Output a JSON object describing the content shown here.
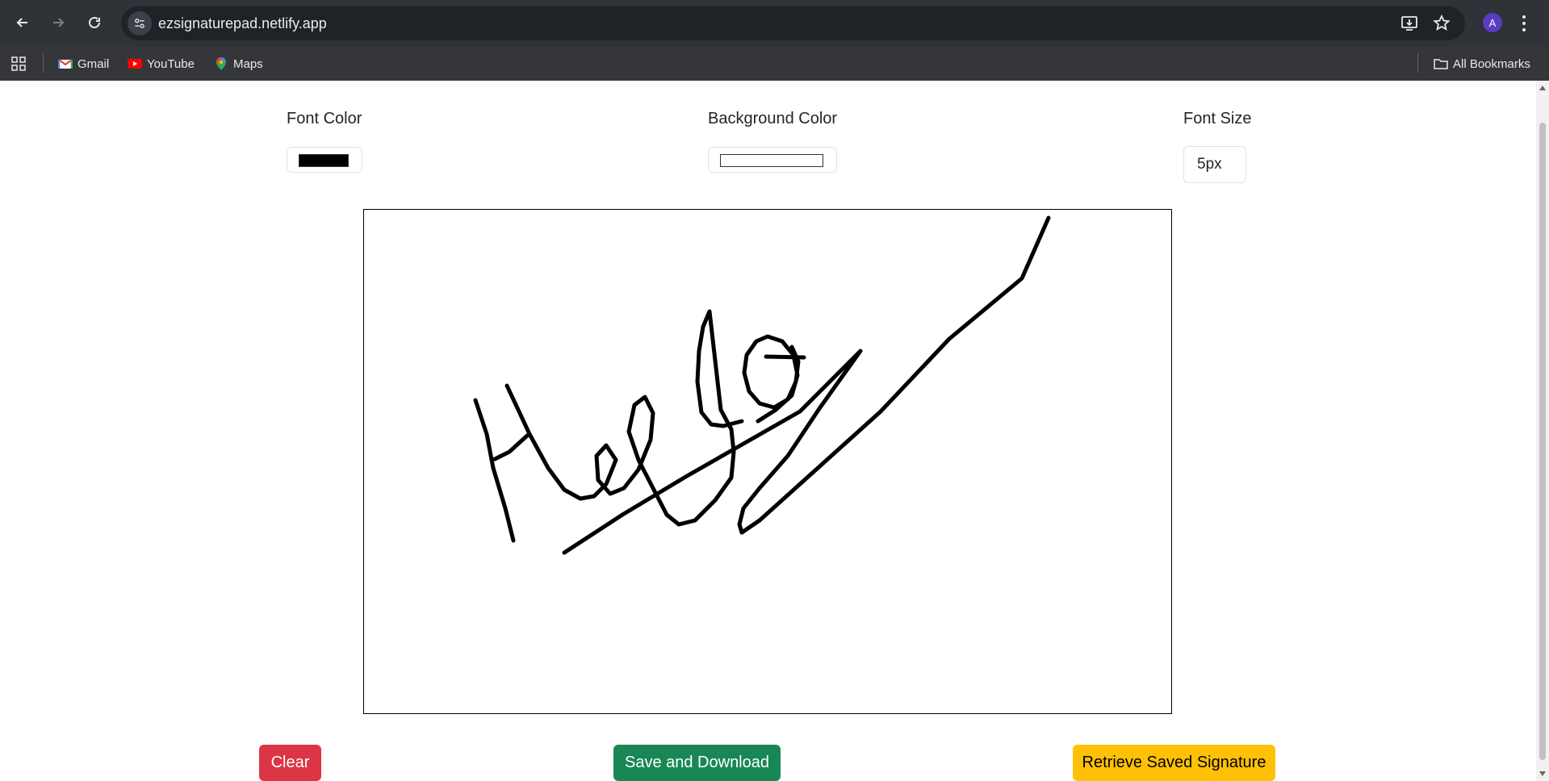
{
  "browser": {
    "url": "ezsignaturepad.netlify.app",
    "profile_initial": "A",
    "bookmarks": [
      {
        "label": "Gmail"
      },
      {
        "label": "YouTube"
      },
      {
        "label": "Maps"
      }
    ],
    "all_bookmarks_label": "All Bookmarks"
  },
  "controls": {
    "font_color_label": "Font Color",
    "font_color_value": "#000000",
    "background_color_label": "Background Color",
    "background_color_value": "#ffffff",
    "font_size_label": "Font Size",
    "font_size_value": "5px"
  },
  "buttons": {
    "clear": "Clear",
    "save_download": "Save and Download",
    "retrieve": "Retrieve Saved Signature"
  },
  "colors": {
    "clear": "#dc3545",
    "save": "#198754",
    "retrieve": "#ffc107"
  }
}
